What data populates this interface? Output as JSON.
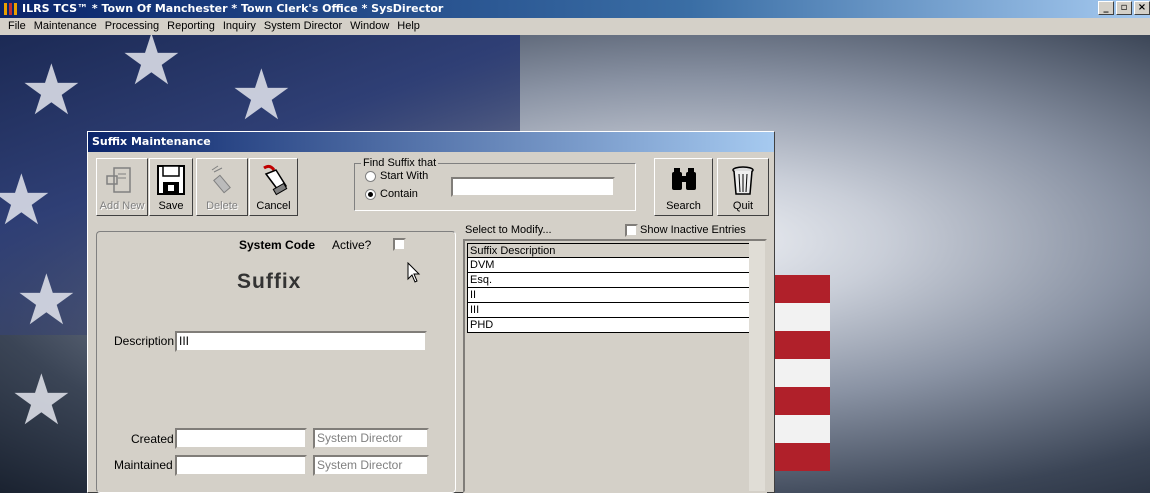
{
  "app": {
    "title": "ILRS TCS™ * Town Of Manchester * Town Clerk's Office * SysDirector",
    "window_buttons": [
      "_",
      "▫",
      "×"
    ]
  },
  "menu": [
    "File",
    "Maintenance",
    "Processing",
    "Reporting",
    "Inquiry",
    "System Director",
    "Window",
    "Help"
  ],
  "child": {
    "title": "Suffix Maintenance",
    "toolbar": {
      "add_new": "Add New",
      "save": "Save",
      "delete": "Delete",
      "cancel": "Cancel",
      "search": "Search",
      "quit": "Quit"
    },
    "find": {
      "legend": "Find Suffix that",
      "start_with": "Start With",
      "contain": "Contain",
      "selected": "Contain",
      "value": ""
    },
    "form": {
      "system_code": "System Code",
      "active_label": "Active?",
      "heading": "Suffix",
      "description_label": "Description",
      "description_value": "III",
      "created_label": "Created",
      "created_value": "",
      "created_by": "System Director",
      "maintained_label": "Maintained",
      "maintained_value": "",
      "maintained_by": "System Director"
    },
    "list": {
      "select_label": "Select to Modify...",
      "show_inactive": "Show Inactive Entries",
      "header": "Suffix Description",
      "rows": [
        "DVM",
        "Esq.",
        "II",
        "III",
        "PHD"
      ]
    }
  },
  "colors": {
    "titlebar": "#0a246a",
    "window_face": "#d4d0c8"
  }
}
